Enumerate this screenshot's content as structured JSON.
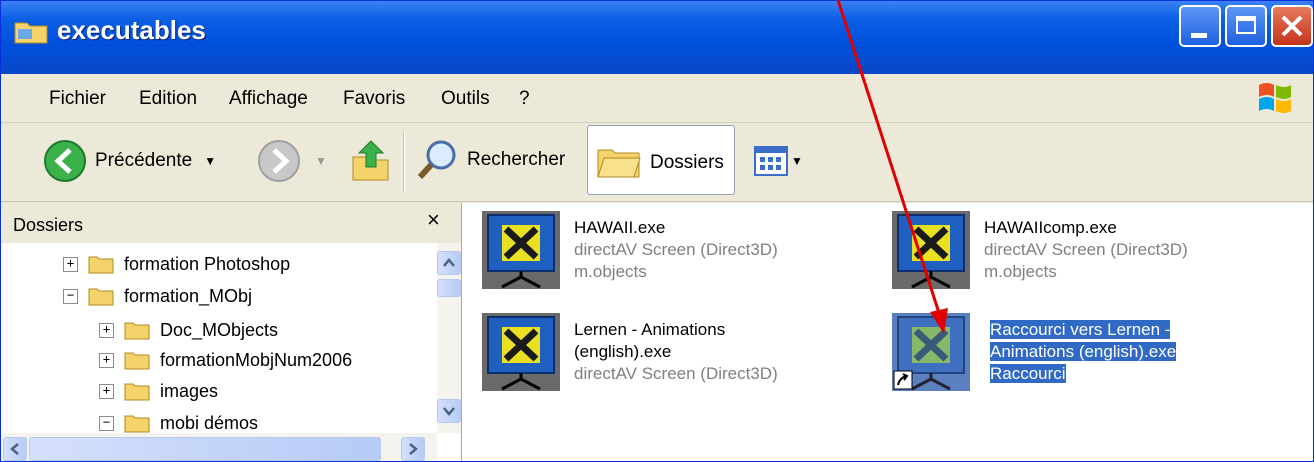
{
  "window": {
    "title": "executables"
  },
  "menu": [
    "Fichier",
    "Edition",
    "Affichage",
    "Favoris",
    "Outils",
    "?"
  ],
  "toolbar": {
    "back_label": "Précédente",
    "search_label": "Rechercher",
    "folders_label": "Dossiers"
  },
  "folders_pane": {
    "title": "Dossiers",
    "close_glyph": "×",
    "tree": [
      {
        "label": "formation Photoshop",
        "expander": "+"
      },
      {
        "label": "formation_MObj",
        "expander": "−"
      },
      {
        "label": "Doc_MObjects",
        "expander": "+"
      },
      {
        "label": "formationMobjNum2006",
        "expander": "+"
      },
      {
        "label": "images",
        "expander": "+"
      },
      {
        "label": "mobi démos",
        "expander": "−"
      }
    ]
  },
  "files": [
    {
      "name": "HAWAII.exe",
      "line2": "directAV Screen (Direct3D)",
      "line3": "m.objects"
    },
    {
      "name": "HAWAIIcomp.exe",
      "line2": "directAV Screen (Direct3D)",
      "line3": "m.objects"
    },
    {
      "name": "Lernen - Animations",
      "line2": "(english).exe",
      "line3": "directAV Screen (Direct3D)"
    },
    {
      "name": "Raccourci vers Lernen -",
      "line2": "Animations (english).exe",
      "line3": "Raccourci"
    }
  ],
  "colors": {
    "selection": "#316ac5",
    "arrow": "#e00000",
    "titlebar": "#0050dc"
  }
}
